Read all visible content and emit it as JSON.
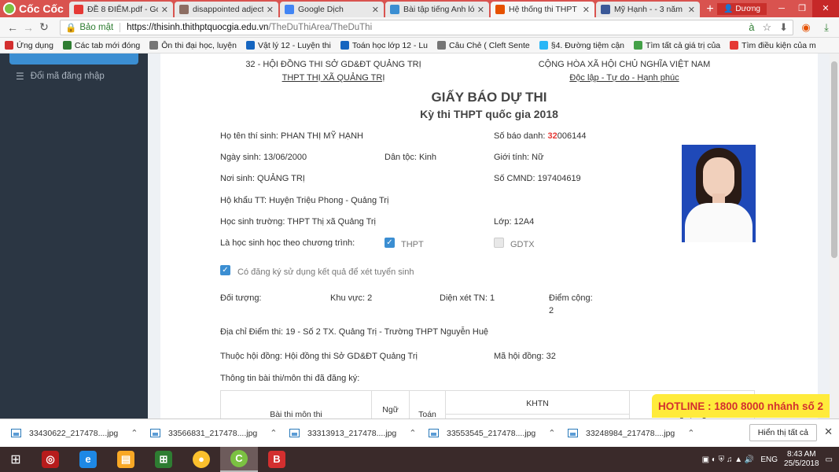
{
  "browser": {
    "brand": "Cốc Cốc",
    "tabs": [
      {
        "label": "ĐỀ 8 ĐIỂM.pdf - Goog",
        "icon": "pdf-icon",
        "color": "#e53935"
      },
      {
        "label": "disappointed adjectiv",
        "icon": "dictionary-icon",
        "color": "#8d6e63"
      },
      {
        "label": "Google Dịch",
        "icon": "document-icon",
        "color": "#4285f4"
      },
      {
        "label": "Bài tập tiếng Anh lớp",
        "icon": "bookmark-icon",
        "color": "#3b8ed2"
      },
      {
        "label": "Hệ thống thi THPT Q...",
        "icon": "coccoc-icon",
        "color": "#e65100"
      },
      {
        "label": "Mỹ Hạnh - - 3 năm =",
        "icon": "facebook-icon",
        "color": "#3b5998"
      }
    ],
    "user": "Dương",
    "secure_label": "Bảo mật",
    "url_host": "https://thisinh.thithptquocgia.edu.vn",
    "url_path": "/TheDuThiArea/TheDuThi",
    "bookmarks": [
      {
        "label": "Ứng dụng",
        "color": "#d32f2f"
      },
      {
        "label": "Các tab mới đóng",
        "color": "#2e7d32"
      },
      {
        "label": "Ôn thi đại học, luyện",
        "color": "#757575"
      },
      {
        "label": "Vật lý 12 - Luyện thi",
        "color": "#1565c0"
      },
      {
        "label": "Toán học lớp 12 - Lu",
        "color": "#1565c0"
      },
      {
        "label": "Câu Chẻ ( Cleft Sente",
        "color": "#757575"
      },
      {
        "label": "§4. Đường tiệm cận",
        "color": "#29b6f6"
      },
      {
        "label": "Tìm tất cả giá trị của",
        "color": "#43a047"
      },
      {
        "label": "Tìm điều kiện của m",
        "color": "#e53935"
      }
    ]
  },
  "sidebar": {
    "item": "Đổi mã đăng nhập"
  },
  "doc": {
    "left_header_1": "32 - HỘI ĐỒNG THI SỞ GD&ĐT QUẢNG TRỊ",
    "left_header_2": "THPT THỊ XÃ QUẢNG TRỊ",
    "right_header_1": "CỘNG HÒA XÃ HỘI CHỦ NGHĨA VIỆT NAM",
    "right_header_2": "Độc lập - Tự do - Hạnh phúc",
    "title": "GIẤY BÁO DỰ THI",
    "subtitle": "Kỳ thi THPT quốc gia 2018",
    "ho_ten": "Họ tên thí sinh: PHAN THỊ MỸ HẠNH",
    "sbd_label": "Số báo danh: ",
    "sbd_red": "32",
    "sbd_rest": "006144",
    "ngay_sinh": "Ngày sinh: 13/06/2000",
    "dan_toc": "Dân tộc: Kinh",
    "gioi_tinh": "Giới tính: Nữ",
    "noi_sinh": "Nơi sinh: QUẢNG TRỊ",
    "cmnd": "Số CMND: 197404619",
    "ho_khau": "Hộ khẩu TT: Huyện Triệu Phong - Quảng Trị",
    "truong": "Học sinh trường: THPT Thị xã Quảng Trị",
    "lop": "Lớp: 12A4",
    "chuong_trinh": "Là học sinh học theo chương trình:",
    "thpt": "THPT",
    "gdtx": "GDTX",
    "xet_tuyen": "Có đăng ký sử dụng kết quả để xét tuyển sinh",
    "doi_tuong": "Đối tượng:",
    "khu_vuc": "Khu vực: 2",
    "dien_xet": "Diện xét TN: 1",
    "diem_cong": "Điểm cộng:",
    "diem_cong_val": "2",
    "dia_chi": "Địa chỉ Điểm thi: 19 - Số 2 TX. Quảng Trị - Trường THPT Nguyễn Huệ",
    "hoi_dong": "Thuộc hội đồng:  Hội đồng thi Sở GD&ĐT Quảng Trị",
    "ma_hoi_dong": "Mã hội đồng:  32",
    "thong_tin": "Thông tin bài thi/môn thi đã đăng ký:",
    "table_headers": [
      "Bài thi môn thi",
      "Ngữ",
      "Toán",
      "KHTN",
      "Ngoại ngữ"
    ]
  },
  "hotline": "HOTLINE : 1800 8000 nhánh số 2",
  "downloads": {
    "files": [
      "33430622_217478....jpg",
      "33566831_217478....jpg",
      "33313913_217478....jpg",
      "33553545_217478....jpg",
      "33248984_217478....jpg"
    ],
    "show_all": "Hiển thị tất cả"
  },
  "taskbar": {
    "lang": "ENG",
    "time": "8:43 AM",
    "date": "25/5/2018"
  }
}
